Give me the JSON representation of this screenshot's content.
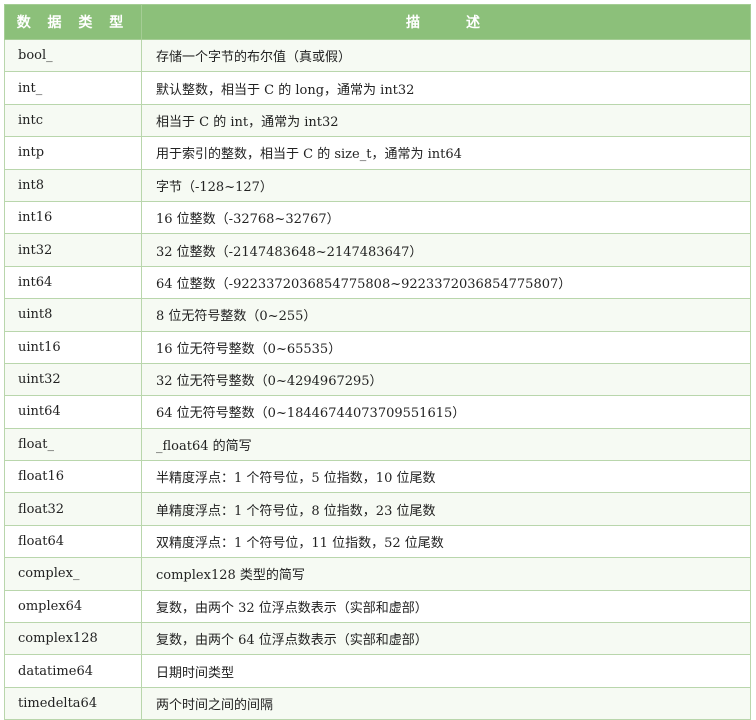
{
  "table": {
    "headers": [
      "数 据 类 型",
      "描　　述"
    ],
    "rows": [
      [
        "bool_",
        "存储一个字节的布尔值（真或假）"
      ],
      [
        "int_",
        "默认整数，相当于 C 的 long，通常为 int32"
      ],
      [
        "intc",
        "相当于 C 的 int，通常为 int32"
      ],
      [
        "intp",
        "用于索引的整数，相当于 C 的 size_t，通常为 int64"
      ],
      [
        "int8",
        "字节（-128~127）"
      ],
      [
        "int16",
        "16 位整数（-32768~32767）"
      ],
      [
        "int32",
        "32 位整数（-2147483648~2147483647）"
      ],
      [
        "int64",
        "64 位整数（-9223372036854775808~9223372036854775807）"
      ],
      [
        "uint8",
        "8 位无符号整数（0~255）"
      ],
      [
        "uint16",
        "16 位无符号整数（0~65535）"
      ],
      [
        "uint32",
        "32 位无符号整数（0~4294967295）"
      ],
      [
        "uint64",
        "64 位无符号整数（0~18446744073709551615）"
      ],
      [
        "float_",
        "_float64 的简写"
      ],
      [
        "float16",
        "半精度浮点：1 个符号位，5 位指数，10 位尾数"
      ],
      [
        "float32",
        "单精度浮点：1 个符号位，8 位指数，23 位尾数"
      ],
      [
        "float64",
        "双精度浮点：1 个符号位，11 位指数，52 位尾数"
      ],
      [
        "complex_",
        "complex128 类型的简写"
      ],
      [
        "omplex64",
        "复数，由两个 32 位浮点数表示（实部和虚部）"
      ],
      [
        "complex128",
        "复数，由两个 64 位浮点数表示（实部和虚部）"
      ],
      [
        "datatime64",
        "日期时间类型"
      ],
      [
        "timedelta64",
        "两个时间之间的间隔"
      ]
    ]
  }
}
